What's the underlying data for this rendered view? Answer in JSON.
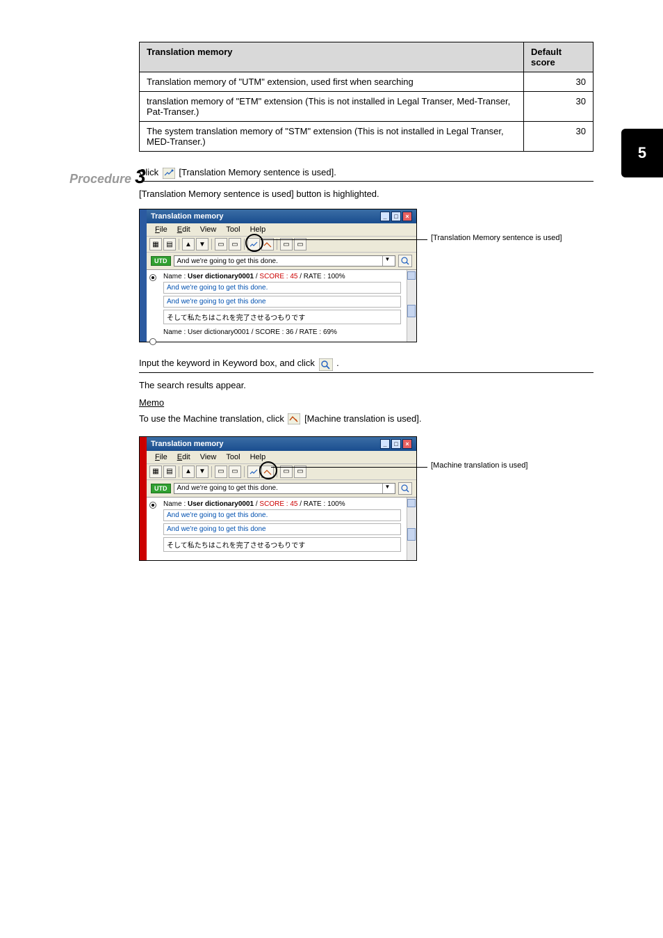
{
  "side_tab": "5",
  "table": {
    "headers": [
      "Translation memory",
      "Default score"
    ],
    "rows": [
      [
        "Translation memory of \"UTM\" extension, used first when searching",
        "30"
      ],
      [
        "translation memory of \"ETM\" extension (This is not installed in Legal Transer, Med-Transer, Pat-Transer.)",
        "30"
      ],
      [
        "The system translation memory of \"STM\" extension (This is not installed in Legal Transer, MED-Transer.)",
        "30"
      ]
    ]
  },
  "step3": {
    "label_styled": "Procedure",
    "label_num": "3",
    "line1": "Click ",
    "line1b": " [Translation Memory sentence is used]. ",
    "line2": "[Translation Memory sentence is used] button is highlighted.",
    "callout": "[Translation Memory sentence is used]"
  },
  "step4": {
    "line1": "Input the keyword in Keyword box, and click ",
    "line1b": " .",
    "line2": "The search results appear."
  },
  "memo": {
    "label": "Memo",
    "body1": "To use the Machine translation, click ",
    "body1b": " [Machine translation is used].",
    "callout": "[Machine translation is used]"
  },
  "appwin": {
    "title": "Translation memory",
    "menu": {
      "file": "File",
      "edit": "Edit",
      "view": "View",
      "tool": "Tool",
      "help": "Help"
    },
    "searchtext": "And we're going to get this done.",
    "utd": "UTD",
    "r1_name": "Name :",
    "r1_dict": "User dictionary0001",
    "r1_midA": " / ",
    "r1_score_label": "SCORE : ",
    "r1_score": "45",
    "r1_midB": " / RATE : ",
    "r1_rate": "100%",
    "r1_en": "And we're going to get this done.",
    "r1_en2": "And we're going to get this done",
    "r1_ja": "そして私たちはこれを完了させるつもりです",
    "r2_name": "Name :",
    "r2_dict": "User dictionary0001",
    "r2_score_label": "SCORE : ",
    "r2_score": "36",
    "r2_rate": "69%"
  }
}
